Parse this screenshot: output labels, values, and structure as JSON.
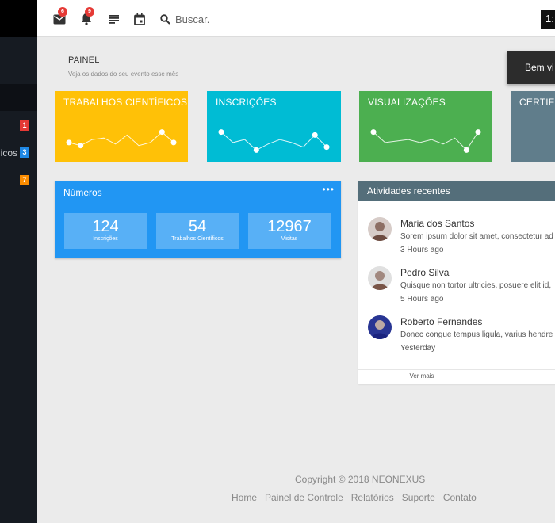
{
  "sidebar": {
    "items": [
      {
        "label": "",
        "badge": "1",
        "badge_color": "#e53935"
      },
      {
        "label": "icos",
        "badge": "3",
        "badge_color": "#1e88e5"
      },
      {
        "label": "",
        "badge": "7",
        "badge_color": "#fb8c00"
      }
    ]
  },
  "topbar": {
    "icons": [
      {
        "name": "mail-icon",
        "badge": "6"
      },
      {
        "name": "bell-icon",
        "badge": "9"
      },
      {
        "name": "list-icon"
      },
      {
        "name": "calendar-icon"
      }
    ],
    "search_placeholder": "Buscar.",
    "clock_text": "1:"
  },
  "page": {
    "title": "PAINEL",
    "subtitle": "Veja os dados do seu evento esse mês",
    "welcome": "Bem vi"
  },
  "stats": [
    {
      "title": "TRABALHOS CIENTÍFICOS",
      "color": "#ffc107",
      "sparkline": [
        0.45,
        0.35,
        0.55,
        0.6,
        0.4,
        0.7,
        0.35,
        0.45,
        0.8,
        0.45
      ]
    },
    {
      "title": "INSCRIÇÕES",
      "color": "#00bcd4",
      "sparkline": [
        0.8,
        0.45,
        0.55,
        0.2,
        0.4,
        0.55,
        0.45,
        0.3,
        0.7,
        0.3
      ]
    },
    {
      "title": "VISUALIZAÇÕES",
      "color": "#4caf50",
      "sparkline": [
        0.8,
        0.45,
        0.5,
        0.55,
        0.45,
        0.55,
        0.4,
        0.6,
        0.2,
        0.8
      ]
    },
    {
      "title": "CERTIFI",
      "color": "#607d8b",
      "sparkline": [
        0.5,
        0.6,
        0.4
      ]
    }
  ],
  "numeros": {
    "title": "Números",
    "menu": "•••",
    "boxes": [
      {
        "value": "124",
        "label": "Inscrições"
      },
      {
        "value": "54",
        "label": "Trabalhos Científicos"
      },
      {
        "value": "12967",
        "label": "Visitas"
      }
    ]
  },
  "activities": {
    "title": "Atividades recentes",
    "items": [
      {
        "name": "Maria dos Santos",
        "message": "Sorem ipsum dolor sit amet, consectetur ad",
        "time": "3 Hours ago",
        "avatar_color": "#8d6e63"
      },
      {
        "name": "Pedro Silva",
        "message": "Quisque non tortor ultricies, posuere elit id,",
        "time": "5 Hours ago",
        "avatar_color": "#a1887f"
      },
      {
        "name": "Roberto Fernandes",
        "message": "Donec congue tempus ligula, varius hendre",
        "time": "Yesterday",
        "avatar_color": "#3949ab"
      }
    ],
    "more": "Ver mais"
  },
  "footer": {
    "copyright": "Copyright © 2018 NEONEXUS",
    "links": [
      "Home",
      "Painel de Controle",
      "Relatórios",
      "Suporte",
      "Contato"
    ]
  }
}
